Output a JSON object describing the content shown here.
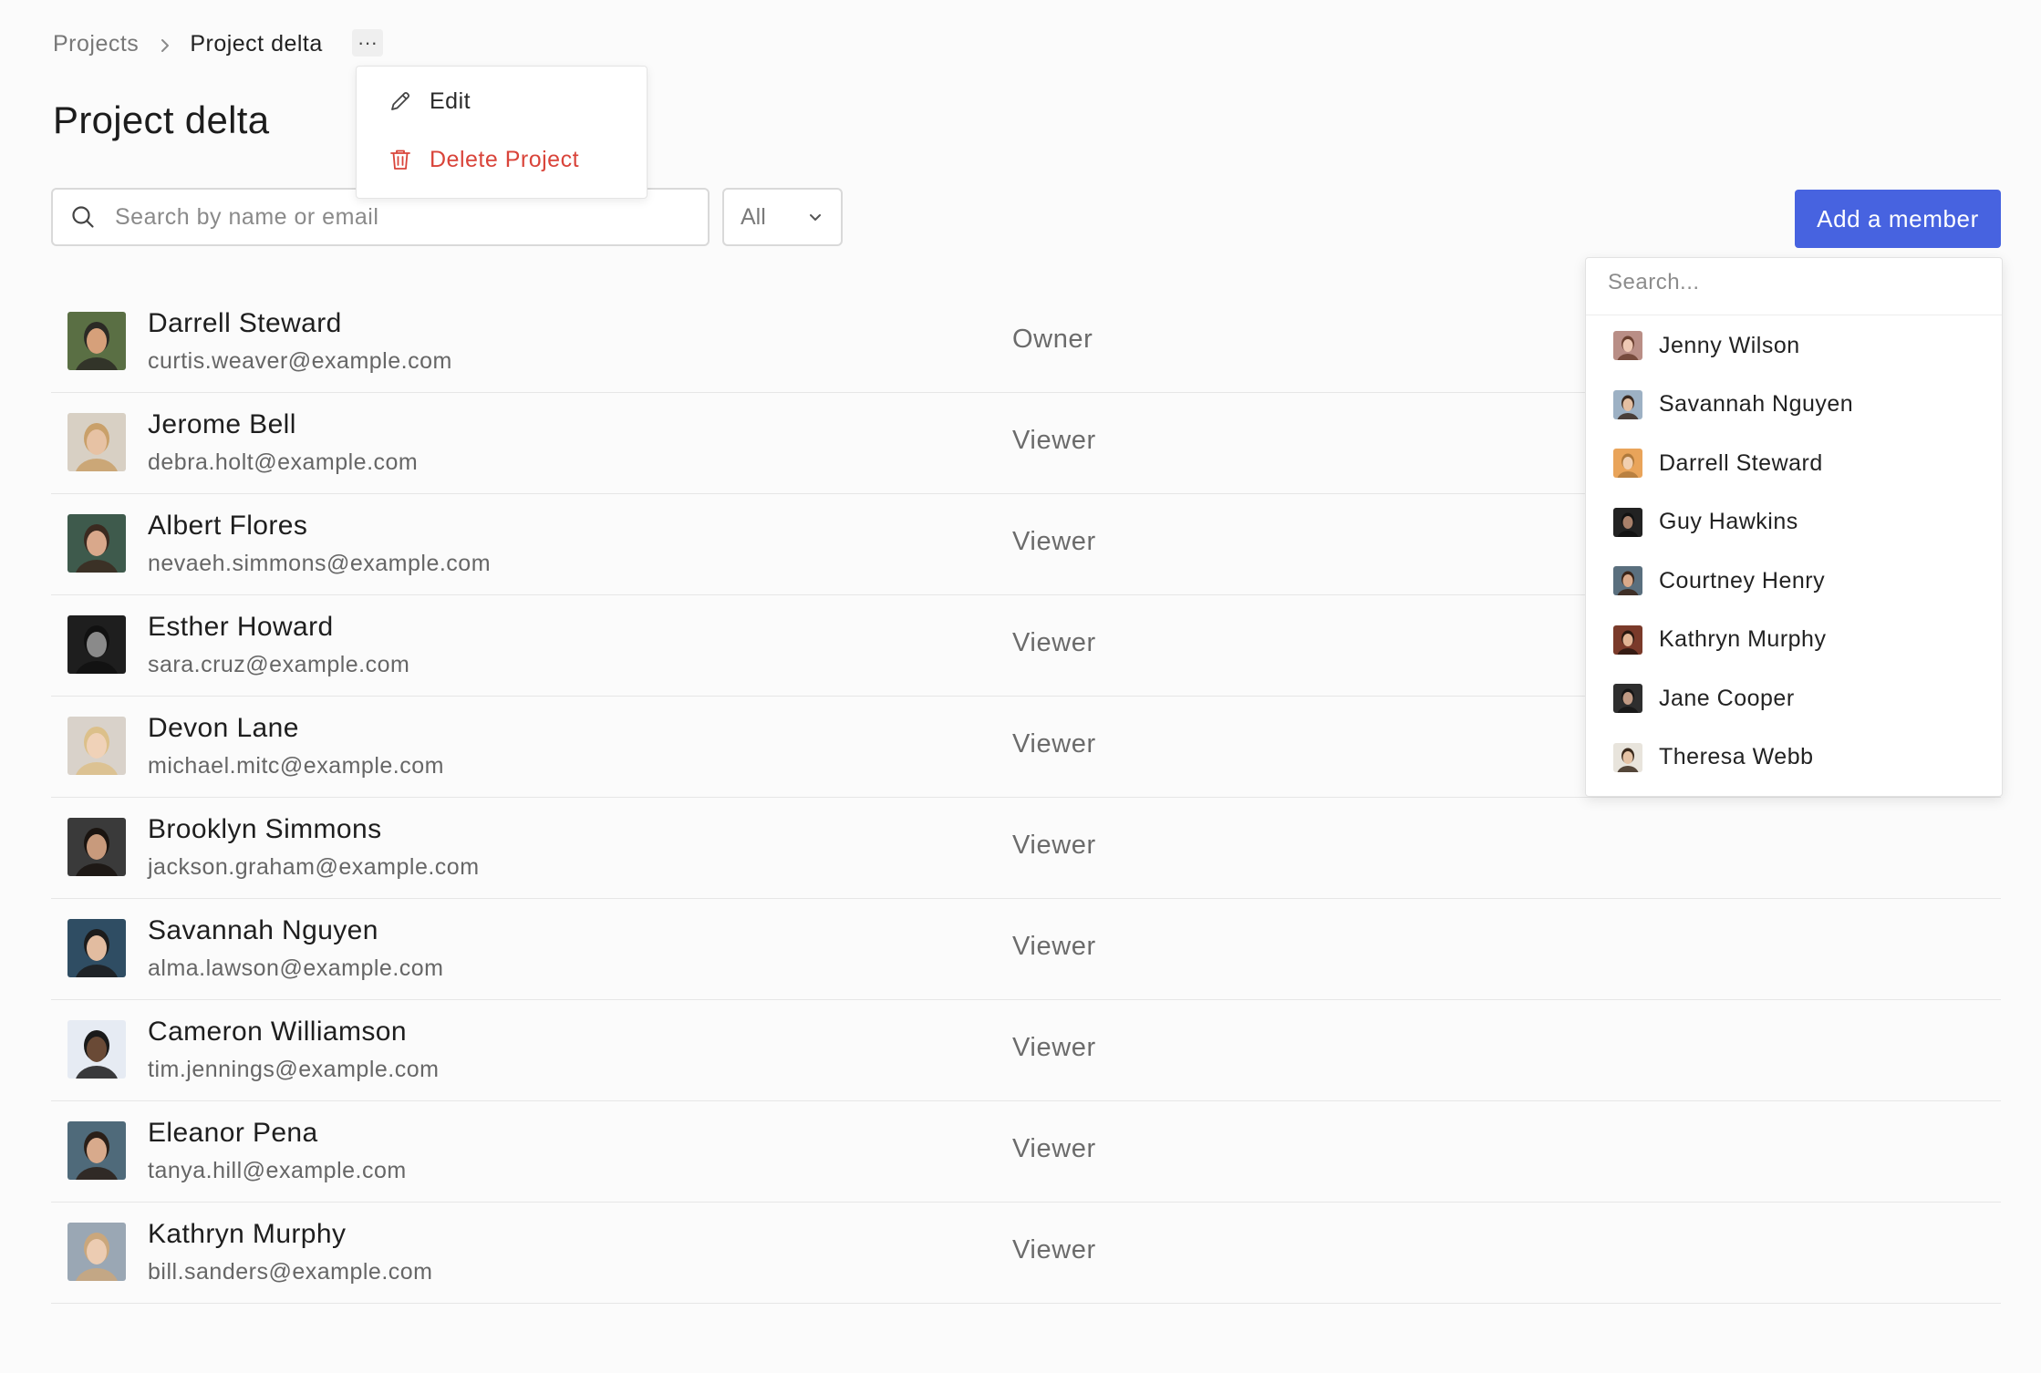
{
  "breadcrumb": {
    "parent": "Projects",
    "current": "Project delta",
    "more": "···"
  },
  "page_title": "Project delta",
  "project_menu": {
    "edit": "Edit",
    "delete": "Delete Project"
  },
  "search": {
    "placeholder": "Search by name or email",
    "value": ""
  },
  "filter": {
    "selected": "All"
  },
  "add_member_button": "Add a member",
  "members": [
    {
      "name": "Darrell Steward",
      "email": "curtis.weaver@example.com",
      "role": "Owner",
      "avatar": {
        "bg": "#5a6f44",
        "fg": "#d6a07a",
        "hair": "#2b2a25"
      }
    },
    {
      "name": "Jerome Bell",
      "email": "debra.holt@example.com",
      "role": "Viewer",
      "avatar": {
        "bg": "#d8d0c4",
        "fg": "#e7c2a4",
        "hair": "#c9a06a"
      }
    },
    {
      "name": "Albert Flores",
      "email": "nevaeh.simmons@example.com",
      "role": "Viewer",
      "avatar": {
        "bg": "#3e5a4c",
        "fg": "#d9a88b",
        "hair": "#3b2a20"
      }
    },
    {
      "name": "Esther Howard",
      "email": "sara.cruz@example.com",
      "role": "Viewer",
      "avatar": {
        "bg": "#1e1e1e",
        "fg": "#8a8a8a",
        "hair": "#111111"
      }
    },
    {
      "name": "Devon Lane",
      "email": "michael.mitc@example.com",
      "role": "Viewer",
      "avatar": {
        "bg": "#d9d2ca",
        "fg": "#f0d2b8",
        "hair": "#dcc08a"
      }
    },
    {
      "name": "Brooklyn Simmons",
      "email": "jackson.graham@example.com",
      "role": "Viewer",
      "avatar": {
        "bg": "#3a3a3a",
        "fg": "#c89a7c",
        "hair": "#1a1410"
      }
    },
    {
      "name": "Savannah Nguyen",
      "email": "alma.lawson@example.com",
      "role": "Viewer",
      "avatar": {
        "bg": "#2f4d63",
        "fg": "#e2bca0",
        "hair": "#1c1c1c"
      }
    },
    {
      "name": "Cameron Williamson",
      "email": "tim.jennings@example.com",
      "role": "Viewer",
      "avatar": {
        "bg": "#e6ebf3",
        "fg": "#6a4a36",
        "hair": "#1a1a1a"
      }
    },
    {
      "name": "Eleanor Pena",
      "email": "tanya.hill@example.com",
      "role": "Viewer",
      "avatar": {
        "bg": "#4f6a7a",
        "fg": "#d8aa8c",
        "hair": "#2a1f18"
      }
    },
    {
      "name": "Kathryn Murphy",
      "email": "bill.sanders@example.com",
      "role": "Viewer",
      "avatar": {
        "bg": "#9aa7b4",
        "fg": "#ecccb2",
        "hair": "#caa77c"
      }
    }
  ],
  "member_picker": {
    "placeholder": "Search...",
    "options": [
      {
        "name": "Jenny Wilson",
        "avatar": {
          "bg": "#b98e86",
          "fg": "#efc9b4",
          "hair": "#6b4030"
        }
      },
      {
        "name": "Savannah Nguyen",
        "avatar": {
          "bg": "#9db1c4",
          "fg": "#e4bfa2",
          "hair": "#3b2a20"
        }
      },
      {
        "name": "Darrell Steward",
        "avatar": {
          "bg": "#e9a45a",
          "fg": "#f1cfb0",
          "hair": "#b07a3c"
        }
      },
      {
        "name": "Guy Hawkins",
        "avatar": {
          "bg": "#222222",
          "fg": "#a8806a",
          "hair": "#111111"
        }
      },
      {
        "name": "Courtney Henry",
        "avatar": {
          "bg": "#5a6f7e",
          "fg": "#d9a98a",
          "hair": "#3a2418"
        }
      },
      {
        "name": "Kathryn Murphy",
        "avatar": {
          "bg": "#7a3a2a",
          "fg": "#e2b494",
          "hair": "#2a1810"
        }
      },
      {
        "name": "Jane Cooper",
        "avatar": {
          "bg": "#2e2e2e",
          "fg": "#c09a84",
          "hair": "#151515"
        }
      },
      {
        "name": "Theresa Webb",
        "avatar": {
          "bg": "#e8e4dc",
          "fg": "#e6c4a6",
          "hair": "#3a2a1c"
        }
      }
    ]
  }
}
